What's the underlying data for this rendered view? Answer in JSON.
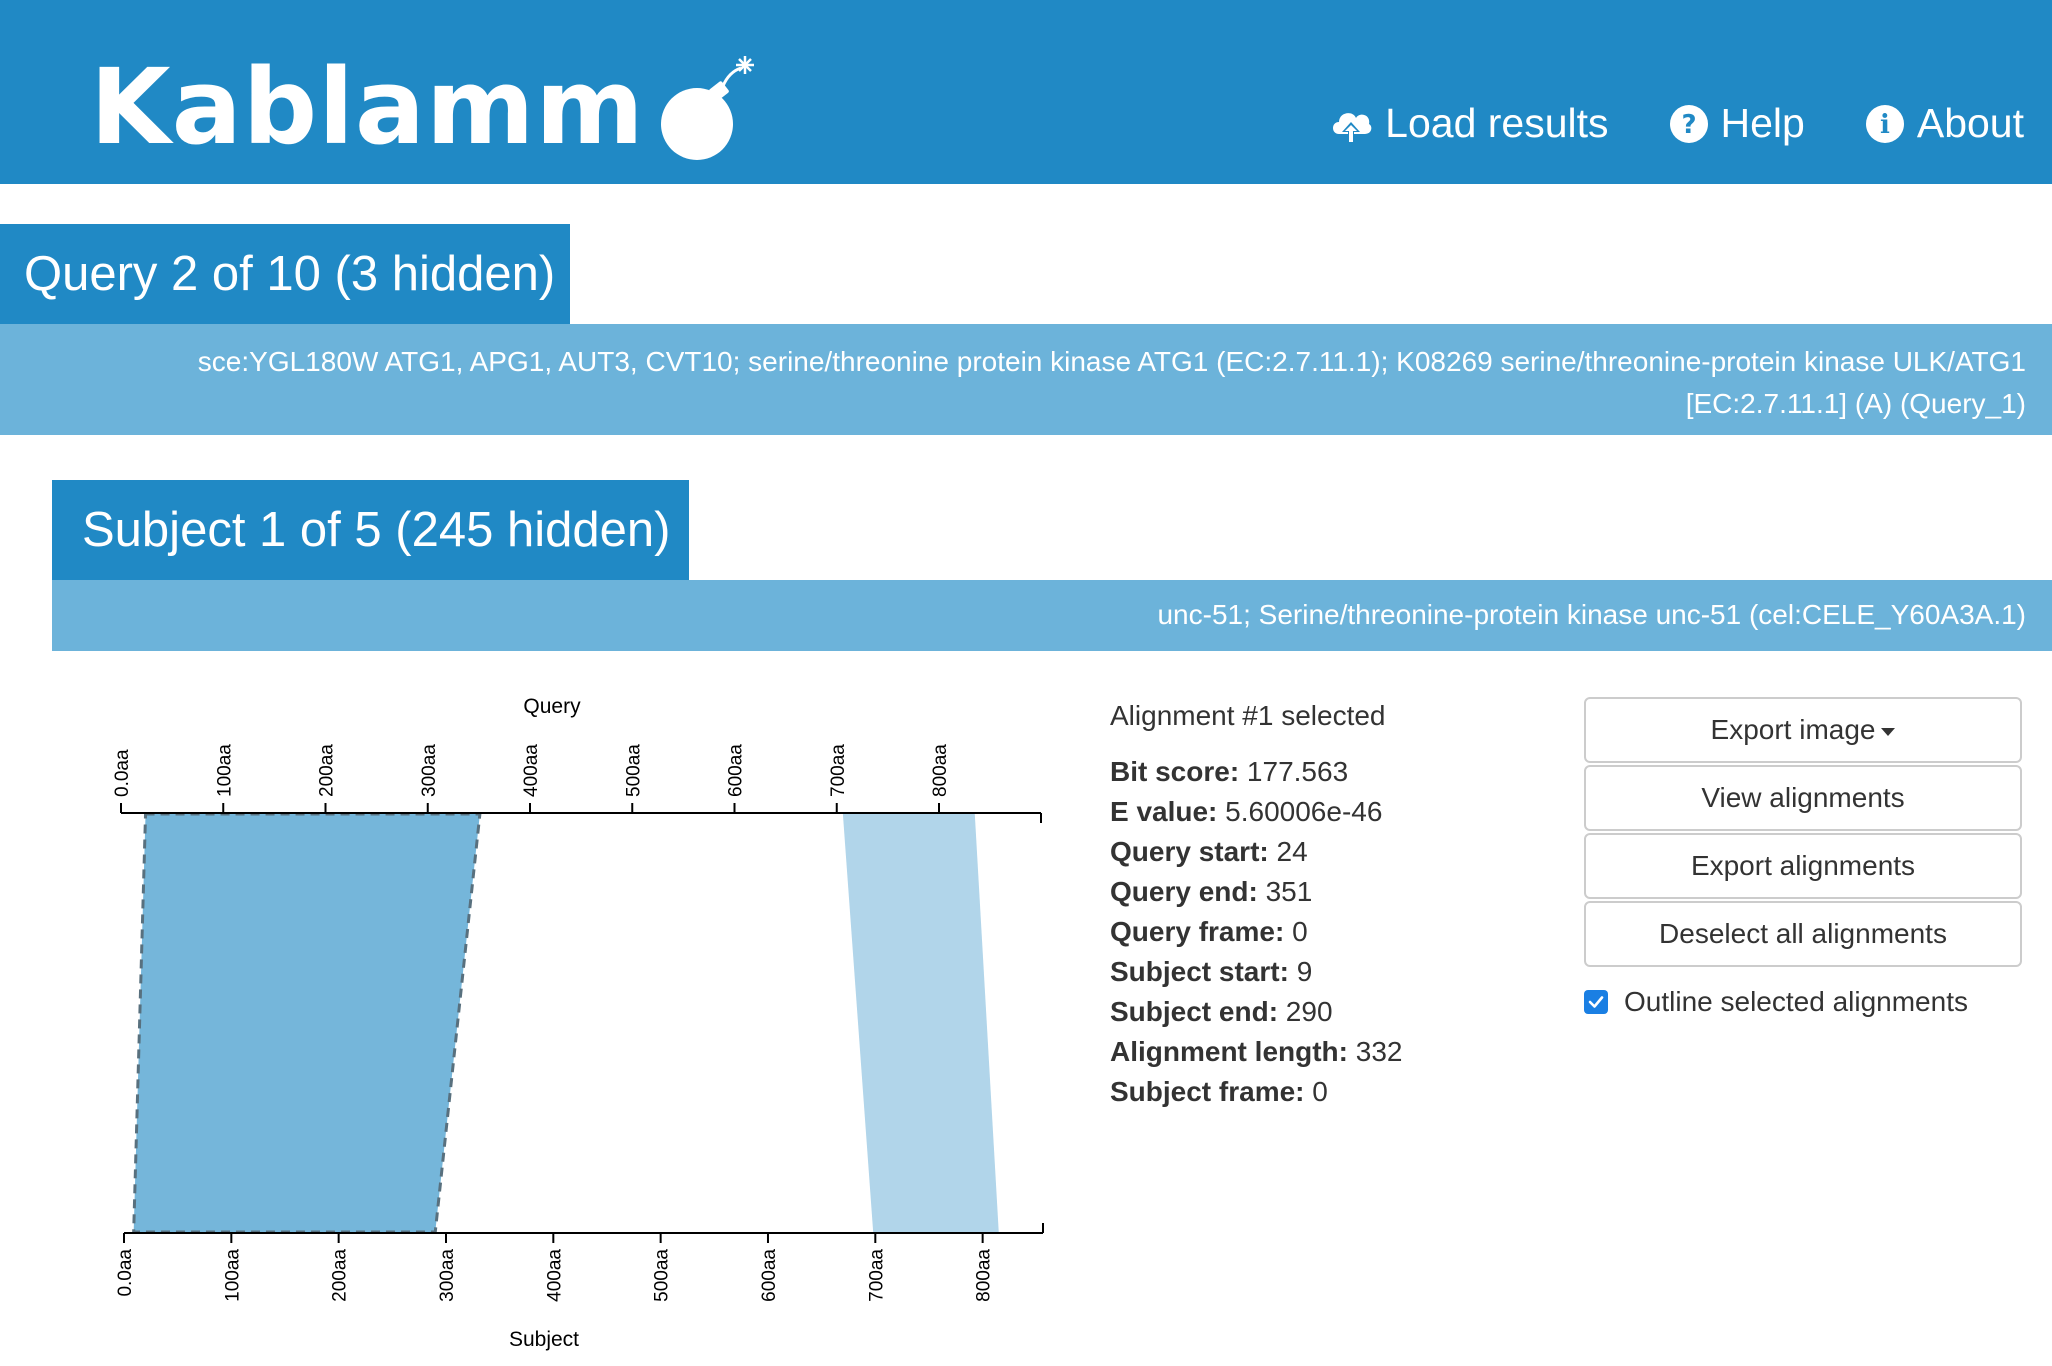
{
  "navbar": {
    "brand": "Kablammo",
    "brand_prefix": "Kablamm",
    "links": [
      {
        "label": "Load results",
        "icon": "cloud-upload-icon"
      },
      {
        "label": "Help",
        "icon": "question-circle-icon"
      },
      {
        "label": "About",
        "icon": "info-circle-icon"
      }
    ]
  },
  "query": {
    "title": "Query 2 of 10 (3 hidden)",
    "description": "sce:YGL180W ATG1, APG1, AUT3, CVT10; serine/threonine protein kinase ATG1 (EC:2.7.11.1); K08269 serine/threonine-protein kinase ULK/ATG1 [EC:2.7.11.1] (A) (Query_1)"
  },
  "subject": {
    "title": "Subject 1 of 5 (245 hidden)",
    "description": "unc-51; Serine/threonine-protein kinase unc-51 (cel:CELE_Y60A3A.1)"
  },
  "chart_data": {
    "type": "alignment",
    "top_axis": {
      "label": "Query",
      "ticks": [
        "0.0aa",
        "100aa",
        "200aa",
        "300aa",
        "400aa",
        "500aa",
        "600aa",
        "700aa",
        "800aa"
      ],
      "range": [
        0,
        900
      ]
    },
    "bottom_axis": {
      "label": "Subject",
      "ticks": [
        "0.0aa",
        "100aa",
        "200aa",
        "300aa",
        "400aa",
        "500aa",
        "600aa",
        "700aa",
        "800aa"
      ],
      "range": [
        0,
        860
      ]
    },
    "alignments": [
      {
        "query_start": 24,
        "query_end": 351,
        "subject_start": 9,
        "subject_end": 290,
        "selected": true,
        "color": "#75b6da"
      },
      {
        "query_start": 706,
        "query_end": 835,
        "subject_start": 698,
        "subject_end": 815,
        "selected": false,
        "color": "#b1d5ea"
      }
    ]
  },
  "alignment_info": {
    "heading": "Alignment #1 selected",
    "fields": [
      {
        "label": "Bit score:",
        "value": "177.563"
      },
      {
        "label": "E value:",
        "value": "5.60006e-46"
      },
      {
        "label": "Query start:",
        "value": "24"
      },
      {
        "label": "Query end:",
        "value": "351"
      },
      {
        "label": "Query frame:",
        "value": "0"
      },
      {
        "label": "Subject start:",
        "value": "9"
      },
      {
        "label": "Subject end:",
        "value": "290"
      },
      {
        "label": "Alignment length:",
        "value": "332"
      },
      {
        "label": "Subject frame:",
        "value": "0"
      }
    ]
  },
  "actions": {
    "export_image": "Export image",
    "view_alignments": "View alignments",
    "export_alignments": "Export alignments",
    "deselect_all": "Deselect all alignments",
    "outline_label": "Outline selected alignments",
    "outline_checked": true
  },
  "colors": {
    "brand": "#2089c5",
    "desc_bar": "#6cb3da",
    "selected_alignment": "#75b6da",
    "other_alignment": "#b1d5ea",
    "checkbox": "#1a7fe3"
  }
}
